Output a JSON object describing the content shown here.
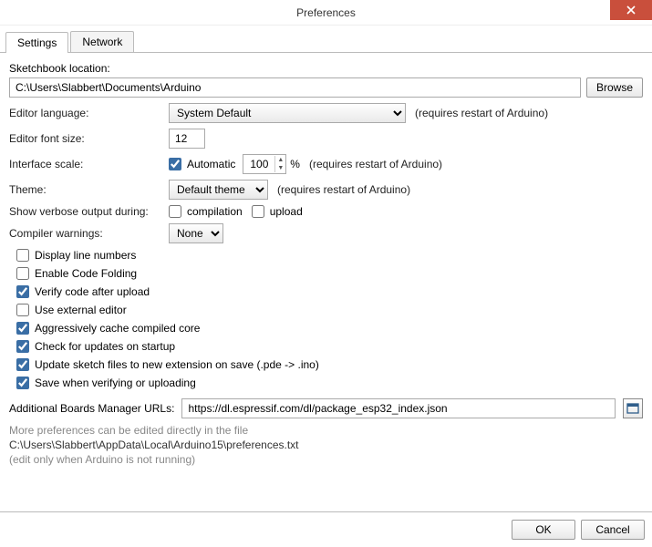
{
  "window": {
    "title": "Preferences"
  },
  "tabs": {
    "settings": "Settings",
    "network": "Network"
  },
  "labels": {
    "sketchbook": "Sketchbook location:",
    "editor_lang": "Editor language:",
    "font_size": "Editor font size:",
    "interface_scale": "Interface scale:",
    "theme": "Theme:",
    "verbose": "Show verbose output during:",
    "compiler_warn": "Compiler warnings:",
    "boards_urls": "Additional Boards Manager URLs:"
  },
  "values": {
    "sketchbook_path": "C:\\Users\\Slabbert\\Documents\\Arduino",
    "editor_lang": "System Default",
    "font_size": "12",
    "scale_percent": "100",
    "theme": "Default theme",
    "compiler_warn": "None",
    "boards_url": "https://dl.espressif.com/dl/package_esp32_index.json"
  },
  "buttons": {
    "browse": "Browse",
    "ok": "OK",
    "cancel": "Cancel"
  },
  "notes": {
    "restart": "(requires restart of Arduino)",
    "percent": "%",
    "more_prefs": "More preferences can be edited directly in the file",
    "prefs_path": "C:\\Users\\Slabbert\\AppData\\Local\\Arduino15\\preferences.txt",
    "edit_only": "(edit only when Arduino is not running)"
  },
  "checkboxes": {
    "automatic": "Automatic",
    "compilation": "compilation",
    "upload": "upload",
    "display_line_numbers": "Display line numbers",
    "enable_code_folding": "Enable Code Folding",
    "verify_after_upload": "Verify code after upload",
    "use_external_editor": "Use external editor",
    "aggressive_cache": "Aggressively cache compiled core",
    "check_updates": "Check for updates on startup",
    "update_ext": "Update sketch files to new extension on save (.pde -> .ino)",
    "save_when_verify": "Save when verifying or uploading"
  },
  "states": {
    "automatic": true,
    "compilation": false,
    "upload": false,
    "display_line_numbers": false,
    "enable_code_folding": false,
    "verify_after_upload": true,
    "use_external_editor": false,
    "aggressive_cache": true,
    "check_updates": true,
    "update_ext": true,
    "save_when_verify": true
  }
}
